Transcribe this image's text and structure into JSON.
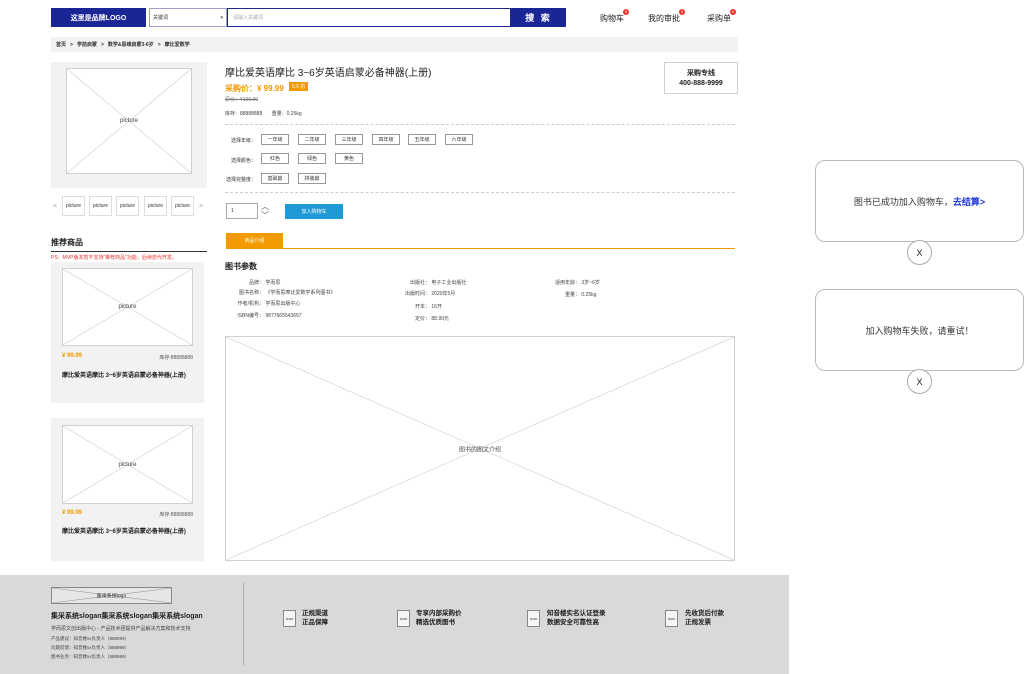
{
  "header": {
    "logo": "这里是品牌LOGO",
    "search_select": "关键词",
    "search_placeholder": "请输入关键词",
    "search_button": "搜 索",
    "links": [
      {
        "label": "购物车",
        "badge": "0"
      },
      {
        "label": "我的审批",
        "badge": "2"
      },
      {
        "label": "采购单",
        "badge": "0"
      }
    ]
  },
  "breadcrumb": [
    "首页",
    ">",
    "学前启蒙",
    ">",
    "数学&思维启蒙3-6岁",
    ">",
    "摩比爱数学"
  ],
  "gallery": {
    "main_label": "picture",
    "thumbs": [
      "picture",
      "picture",
      "picture",
      "picture",
      "picture"
    ],
    "prev": "<",
    "next": ">"
  },
  "recommend": {
    "title": "推荐商品",
    "note": "PS：MVP版本暂不支持“推荐商品”功能，后续迭代开发。",
    "cards": [
      {
        "image": "picture",
        "price": "¥ 99.99",
        "stock": "库存:88888888",
        "name": "摩比爱英语摩比 3~6岁英语启蒙必备神器(上册)"
      },
      {
        "image": "picture",
        "price": "¥ 99.99",
        "stock": "库存:88888888",
        "name": "摩比爱英语摩比 3~6岁英语启蒙必备神器(上册)"
      }
    ]
  },
  "product": {
    "title": "摩比爱英语摩比 3~6岁英语启蒙必备神器(上册)",
    "price_label": "采购价：¥ 99.99",
    "discount": "5.5 折",
    "original_price": "原价：¥199.99",
    "stock": "库存：88888888",
    "weight": "重量：0.25kg",
    "hotline_title": "采购专线",
    "hotline_number": "400-888-9999",
    "options": [
      {
        "label": "选择年级：",
        "values": [
          "一年级",
          "二年级",
          "三年级",
          "四年级",
          "五年级",
          "六年级"
        ]
      },
      {
        "label": "选择颜色：",
        "values": [
          "红色",
          "绿色",
          "黄色"
        ]
      },
      {
        "label": "选择完整度：",
        "values": [
          "基础篇",
          "拼装篇"
        ]
      }
    ],
    "quantity": "1",
    "add_to_cart": "加入购物车",
    "tab": "商品介绍",
    "params_title": "图书参数",
    "params": [
      {
        "k": "品牌：",
        "v": "学而思"
      },
      {
        "k": "出版社：",
        "v": "电子工业出版社"
      },
      {
        "k": "适用年龄：",
        "v": "3岁~6岁"
      },
      {
        "k": "图书名称：",
        "v": "《学而思摩比爱数学系列图书》"
      },
      {
        "k": "出版时间：",
        "v": "2020年5月"
      },
      {
        "k": "重量：",
        "v": "0.25kg"
      },
      {
        "k": "作者/机构：",
        "v": "学而思出版中心"
      },
      {
        "k": "开本：",
        "v": "16开"
      },
      {
        "k": "ISBN编号：",
        "v": "9877665543657"
      },
      {
        "k": "定价：",
        "v": "88.99元"
      }
    ],
    "detail_image": "图书的图文介绍"
  },
  "toasts": {
    "success_text": "图书已成功加入购物车，",
    "success_link": "去结算>",
    "fail_text": "加入购物车失败，请重试！",
    "close": "X"
  },
  "footer": {
    "logo": "集采系统logo",
    "slogan": "集采系统slogan集采系统slogan集采系统slogan",
    "sub": "学而思文创出版中心 - 产品技术团提供产品解决方案和技术支持",
    "contacts": [
      "产品建议：知音楼xx负责人（888999）",
      "问题反馈：知音楼xx负责人（888999）",
      "图书业务：知音楼xx负责人（888999）"
    ],
    "features": [
      {
        "icon": "icon",
        "line1": "正规渠道",
        "line2": "正品保障"
      },
      {
        "icon": "icon",
        "line1": "专享内部采购价",
        "line2": "精选优质图书"
      },
      {
        "icon": "icon",
        "line1": "知音楼实名认证登录",
        "line2": "数据安全可靠性高"
      },
      {
        "icon": "icon",
        "line1": "先收货后付款",
        "line2": "正规发票"
      }
    ]
  }
}
